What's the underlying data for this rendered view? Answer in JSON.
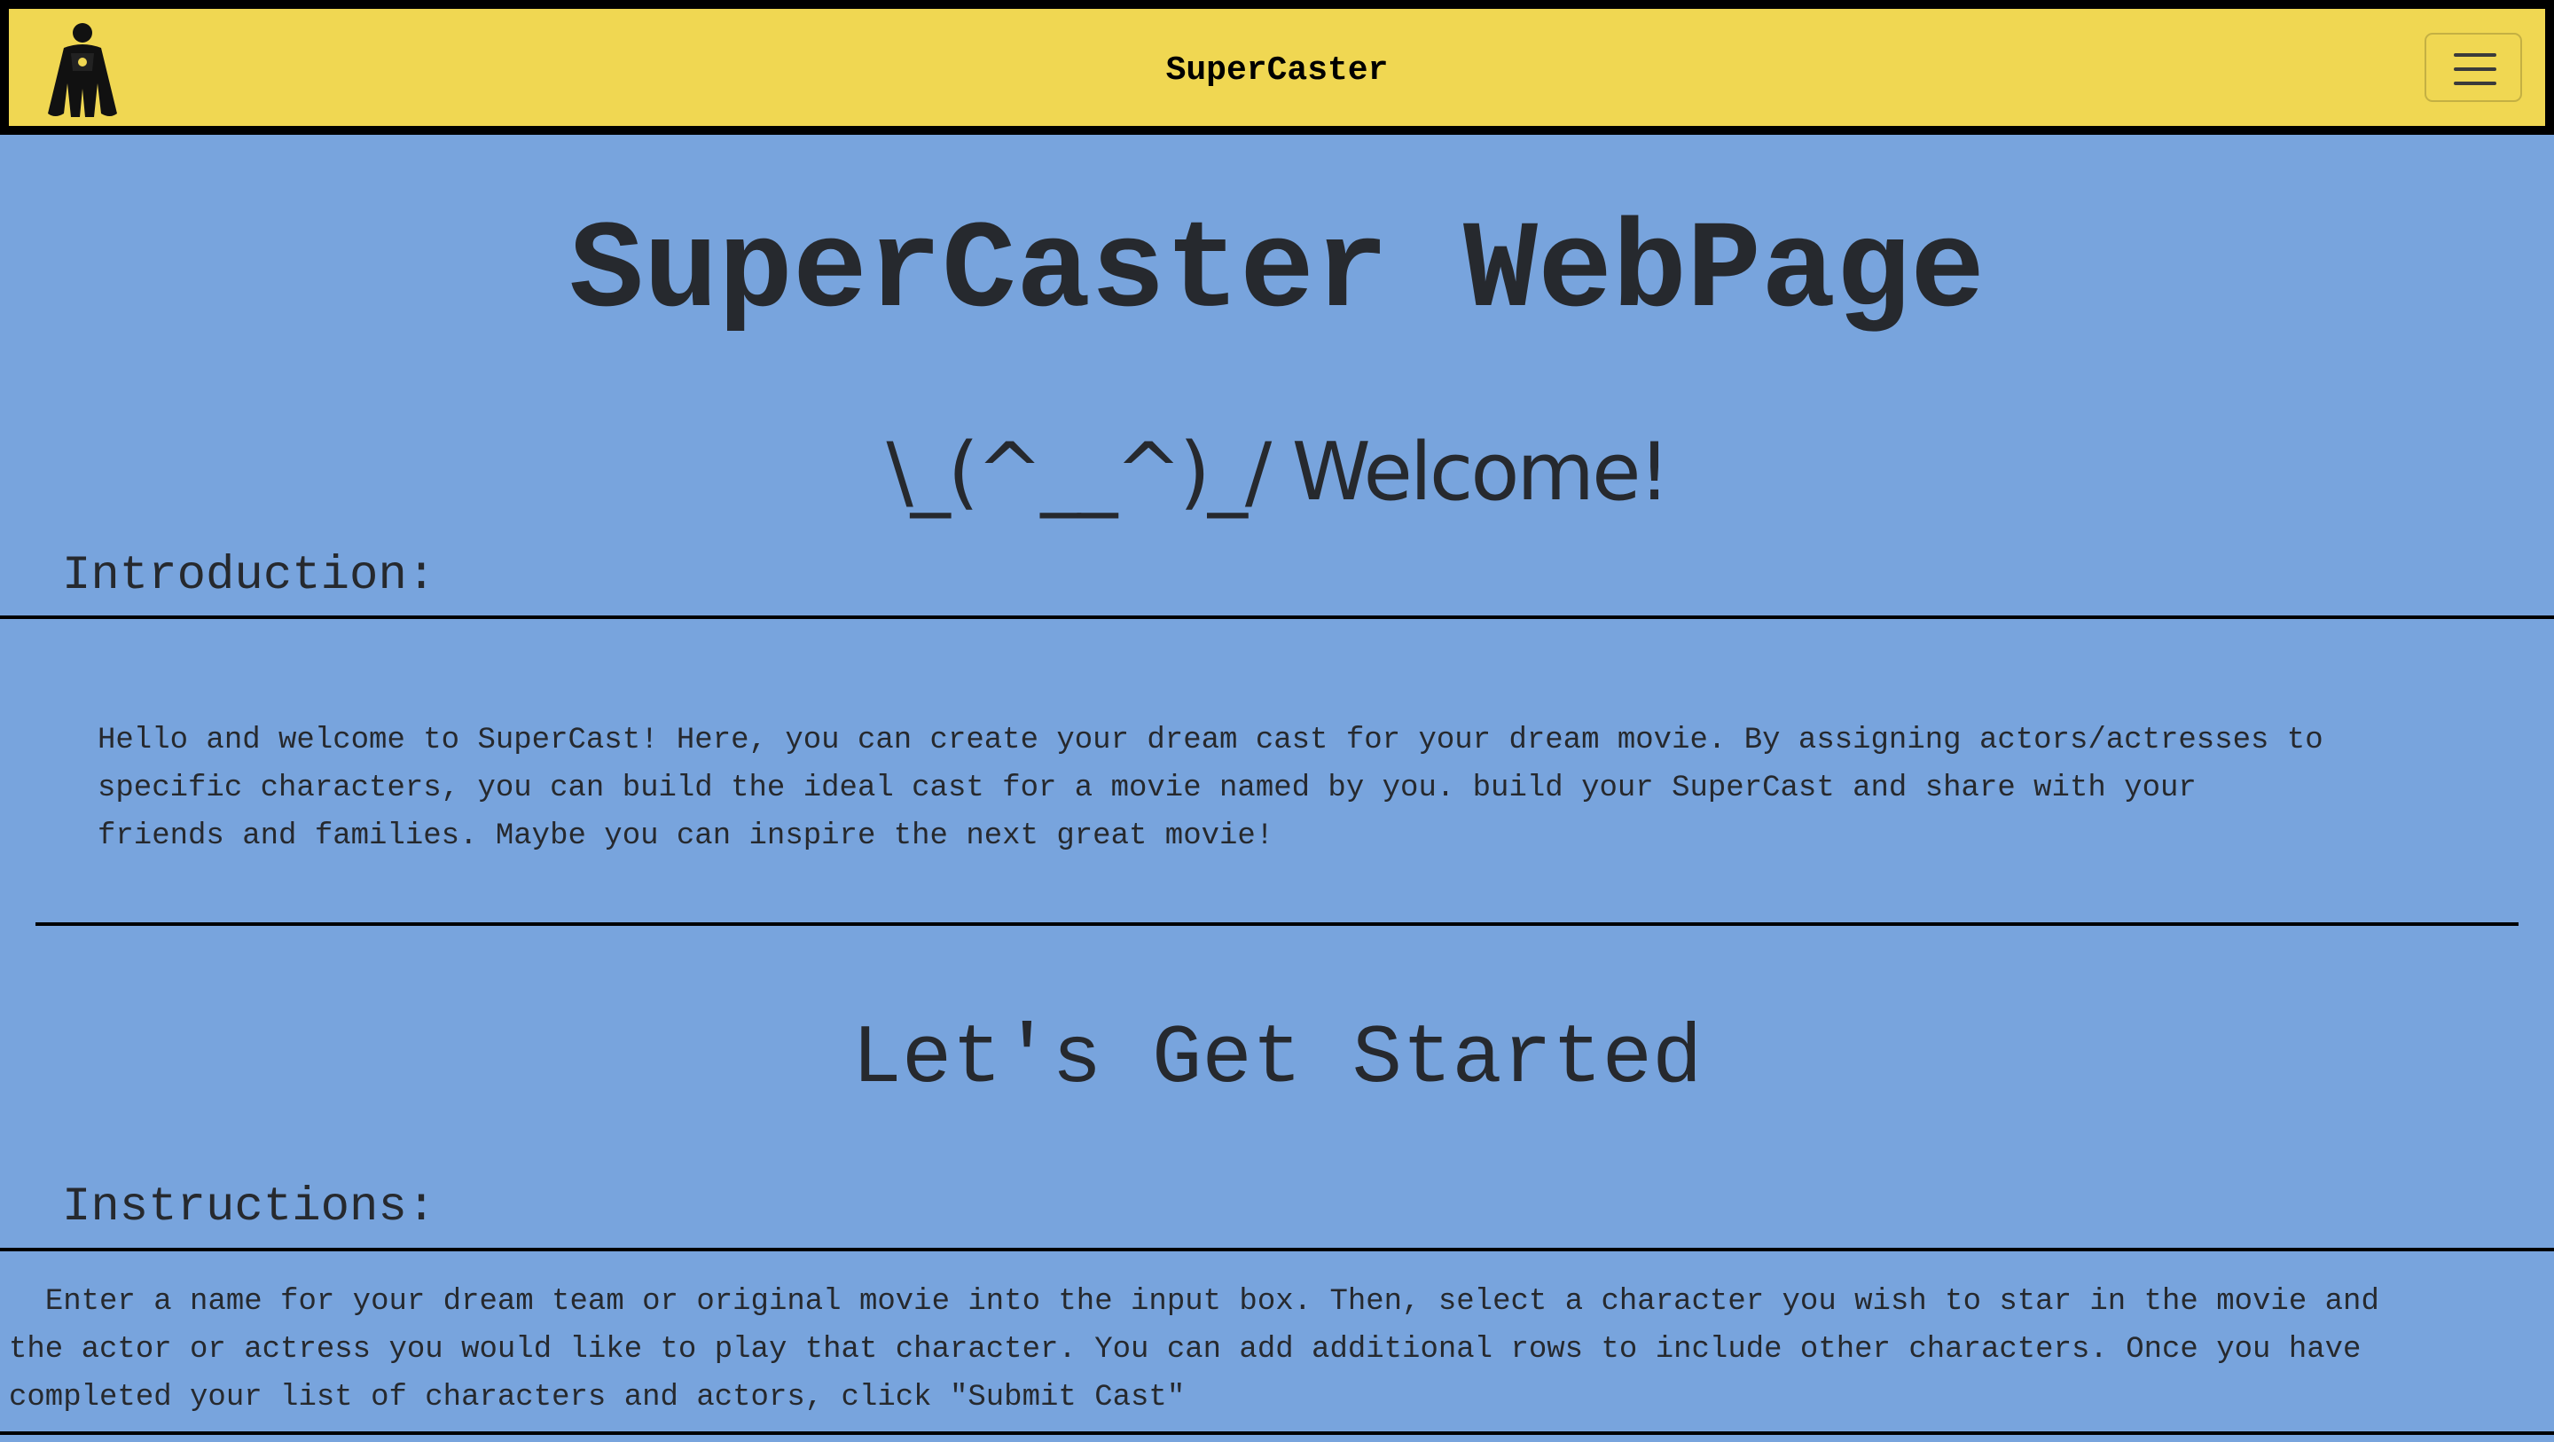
{
  "navbar": {
    "logo_icon": "superhero-caped-icon",
    "brand": "SuperCaster",
    "menu_icon": "hamburger-menu-icon",
    "background": "#f0d752"
  },
  "page_title": "SuperCaster WebPage",
  "welcome": "\\_(^__^)_/ Welcome!",
  "introduction": {
    "heading": "Introduction:",
    "lines": [
      "Hello and welcome to SuperCast! Here, you can create your dream cast for your dream movie. By assigning actors/actresses to",
      "specific characters, you can build the ideal cast for a movie named by you. build your SuperCast and share with your",
      "friends and families. Maybe you can inspire the next great movie!"
    ]
  },
  "get_started": "Let's Get Started",
  "instructions": {
    "heading": "Instructions:",
    "lines": [
      "  Enter a name for your dream team or original movie into the input box. Then, select a character you wish to star in the movie and",
      "the actor or actress you would like to play that character. You can add additional rows to include other characters. Once you have",
      "completed your list of characters and actors, click \"Submit Cast\""
    ]
  },
  "colors": {
    "page_background": "#78a4dd",
    "text": "#26292e",
    "border": "#000000"
  }
}
